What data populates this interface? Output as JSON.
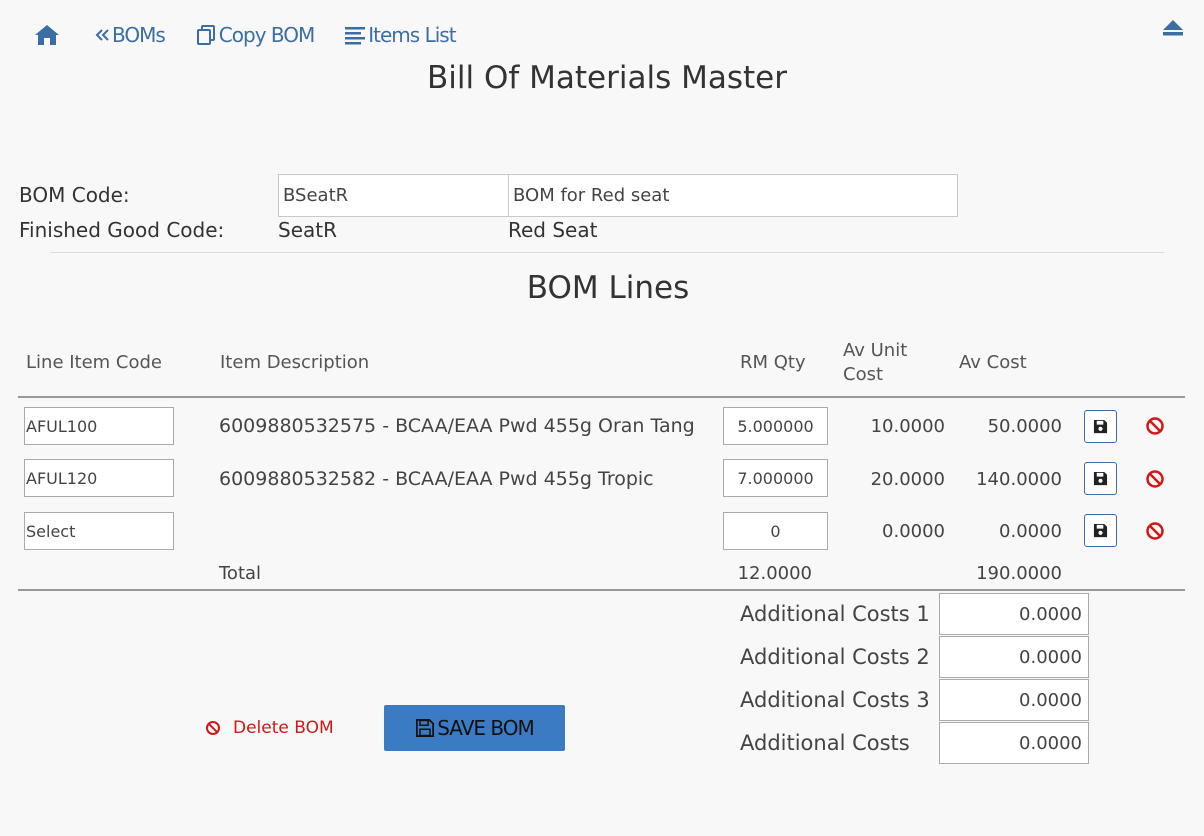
{
  "nav": {
    "boms": "BOMs",
    "copy_bom": "Copy BOM",
    "items_list": "Items List"
  },
  "page_title": "Bill Of Materials Master",
  "header": {
    "bom_code_label": "BOM Code:",
    "bom_code_value": "BSeatR",
    "bom_description_value": "BOM for Red seat",
    "fg_code_label": "Finished Good Code:",
    "fg_code_value": "SeatR",
    "fg_name_value": "Red Seat"
  },
  "lines_title": "BOM Lines",
  "columns": {
    "line_item_code": "Line Item Code",
    "item_description": "Item Description",
    "rm_qty": "RM Qty",
    "av_unit_cost_1": "Av Unit",
    "av_unit_cost_2": "Cost",
    "av_cost": "Av Cost"
  },
  "rows": [
    {
      "code": "AFUL100",
      "description": "6009880532575 - BCAA/EAA Pwd 455g Oran Tang",
      "qty": "5.000000",
      "unit_cost": "10.0000",
      "cost": "50.0000"
    },
    {
      "code": "AFUL120",
      "description": "6009880532582 - BCAA/EAA Pwd 455g Tropic",
      "qty": "7.000000",
      "unit_cost": "20.0000",
      "cost": "140.0000"
    },
    {
      "code": "Select",
      "description": "",
      "qty": "0",
      "unit_cost": "0.0000",
      "cost": "0.0000"
    }
  ],
  "totals": {
    "label": "Total",
    "qty": "12.0000",
    "cost": "190.0000"
  },
  "additional_costs": [
    {
      "label": "Additional Costs 1",
      "value": "0.0000"
    },
    {
      "label": "Additional Costs 2",
      "value": "0.0000"
    },
    {
      "label": "Additional Costs 3",
      "value": "0.0000"
    },
    {
      "label": "Additional Costs",
      "value": "0.0000"
    }
  ],
  "actions": {
    "delete_bom": "Delete BOM",
    "save_bom": "SAVE BOM"
  },
  "colors": {
    "link": "#3a6ea5",
    "danger": "#d01818",
    "primary_button": "#3a7bc4"
  },
  "icons": [
    "home-icon",
    "double-chevron-left-icon",
    "copy-icon",
    "list-icon",
    "eject-icon",
    "floppy-disk-icon",
    "ban-icon"
  ]
}
